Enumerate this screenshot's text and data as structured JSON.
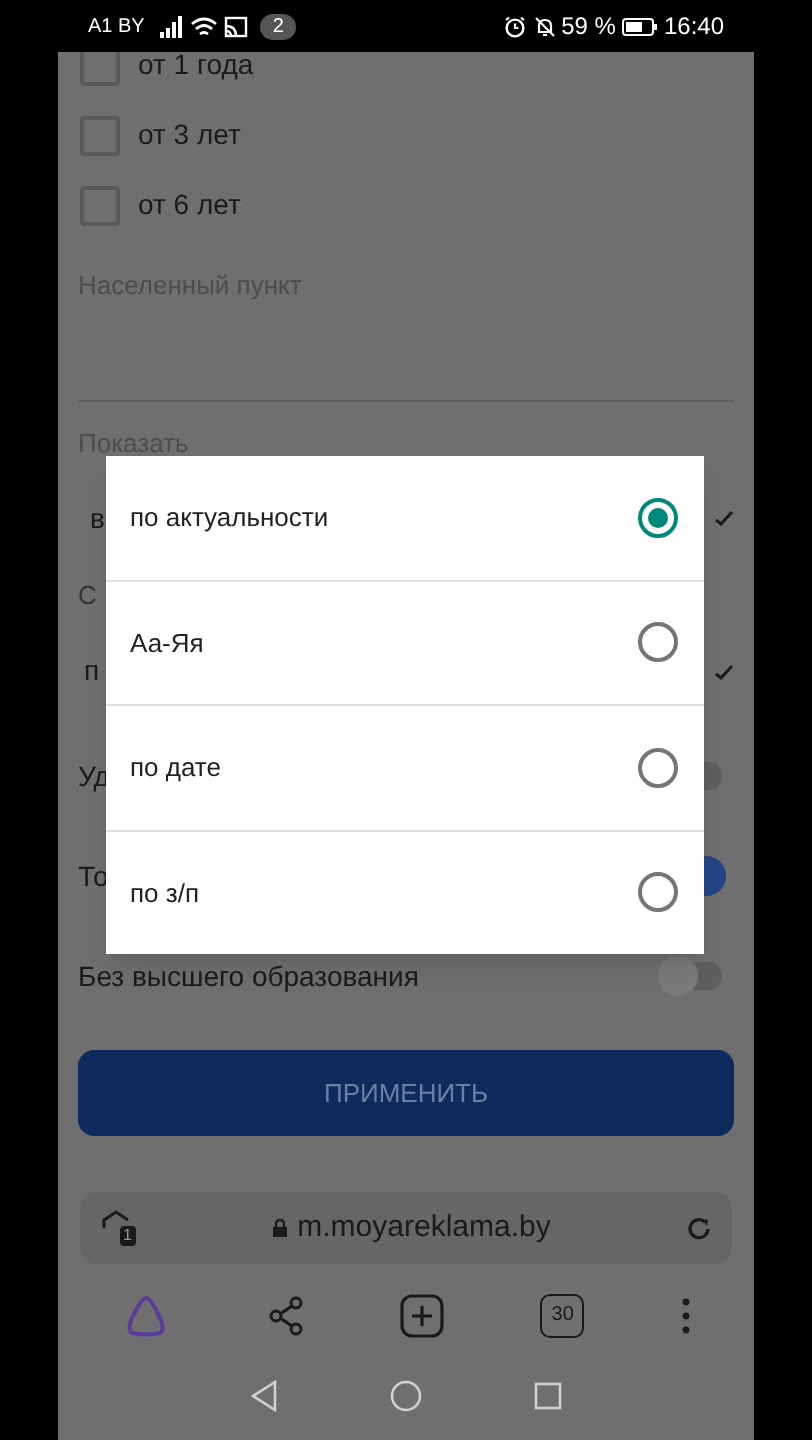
{
  "status_bar": {
    "carrier": "A1 BY",
    "notifications": "2",
    "battery": "59 %",
    "time": "16:40"
  },
  "experience_options": [
    {
      "label": "от 1 года",
      "checked": false
    },
    {
      "label": "от 3 лет",
      "checked": false
    },
    {
      "label": "от 6 лет",
      "checked": false
    }
  ],
  "locality": {
    "label": "Населенный пункт"
  },
  "show": {
    "label": "Показать",
    "value": "в"
  },
  "sort": {
    "label": "С",
    "value": "п"
  },
  "toggles": [
    {
      "label": "Уд",
      "on": false
    },
    {
      "label": "То",
      "on": true
    },
    {
      "label": "Без высшего образования",
      "on": false
    }
  ],
  "apply_button": "ПРИМЕНИТЬ",
  "browser": {
    "tab_badge": "1",
    "url": "m.moyareklama.by",
    "tab_count": "30"
  },
  "sort_dialog": {
    "options": [
      {
        "label": "по актуальности",
        "selected": true
      },
      {
        "label": "Аа-Яя",
        "selected": false
      },
      {
        "label": "по дате",
        "selected": false
      },
      {
        "label": "по з/п",
        "selected": false
      }
    ]
  }
}
